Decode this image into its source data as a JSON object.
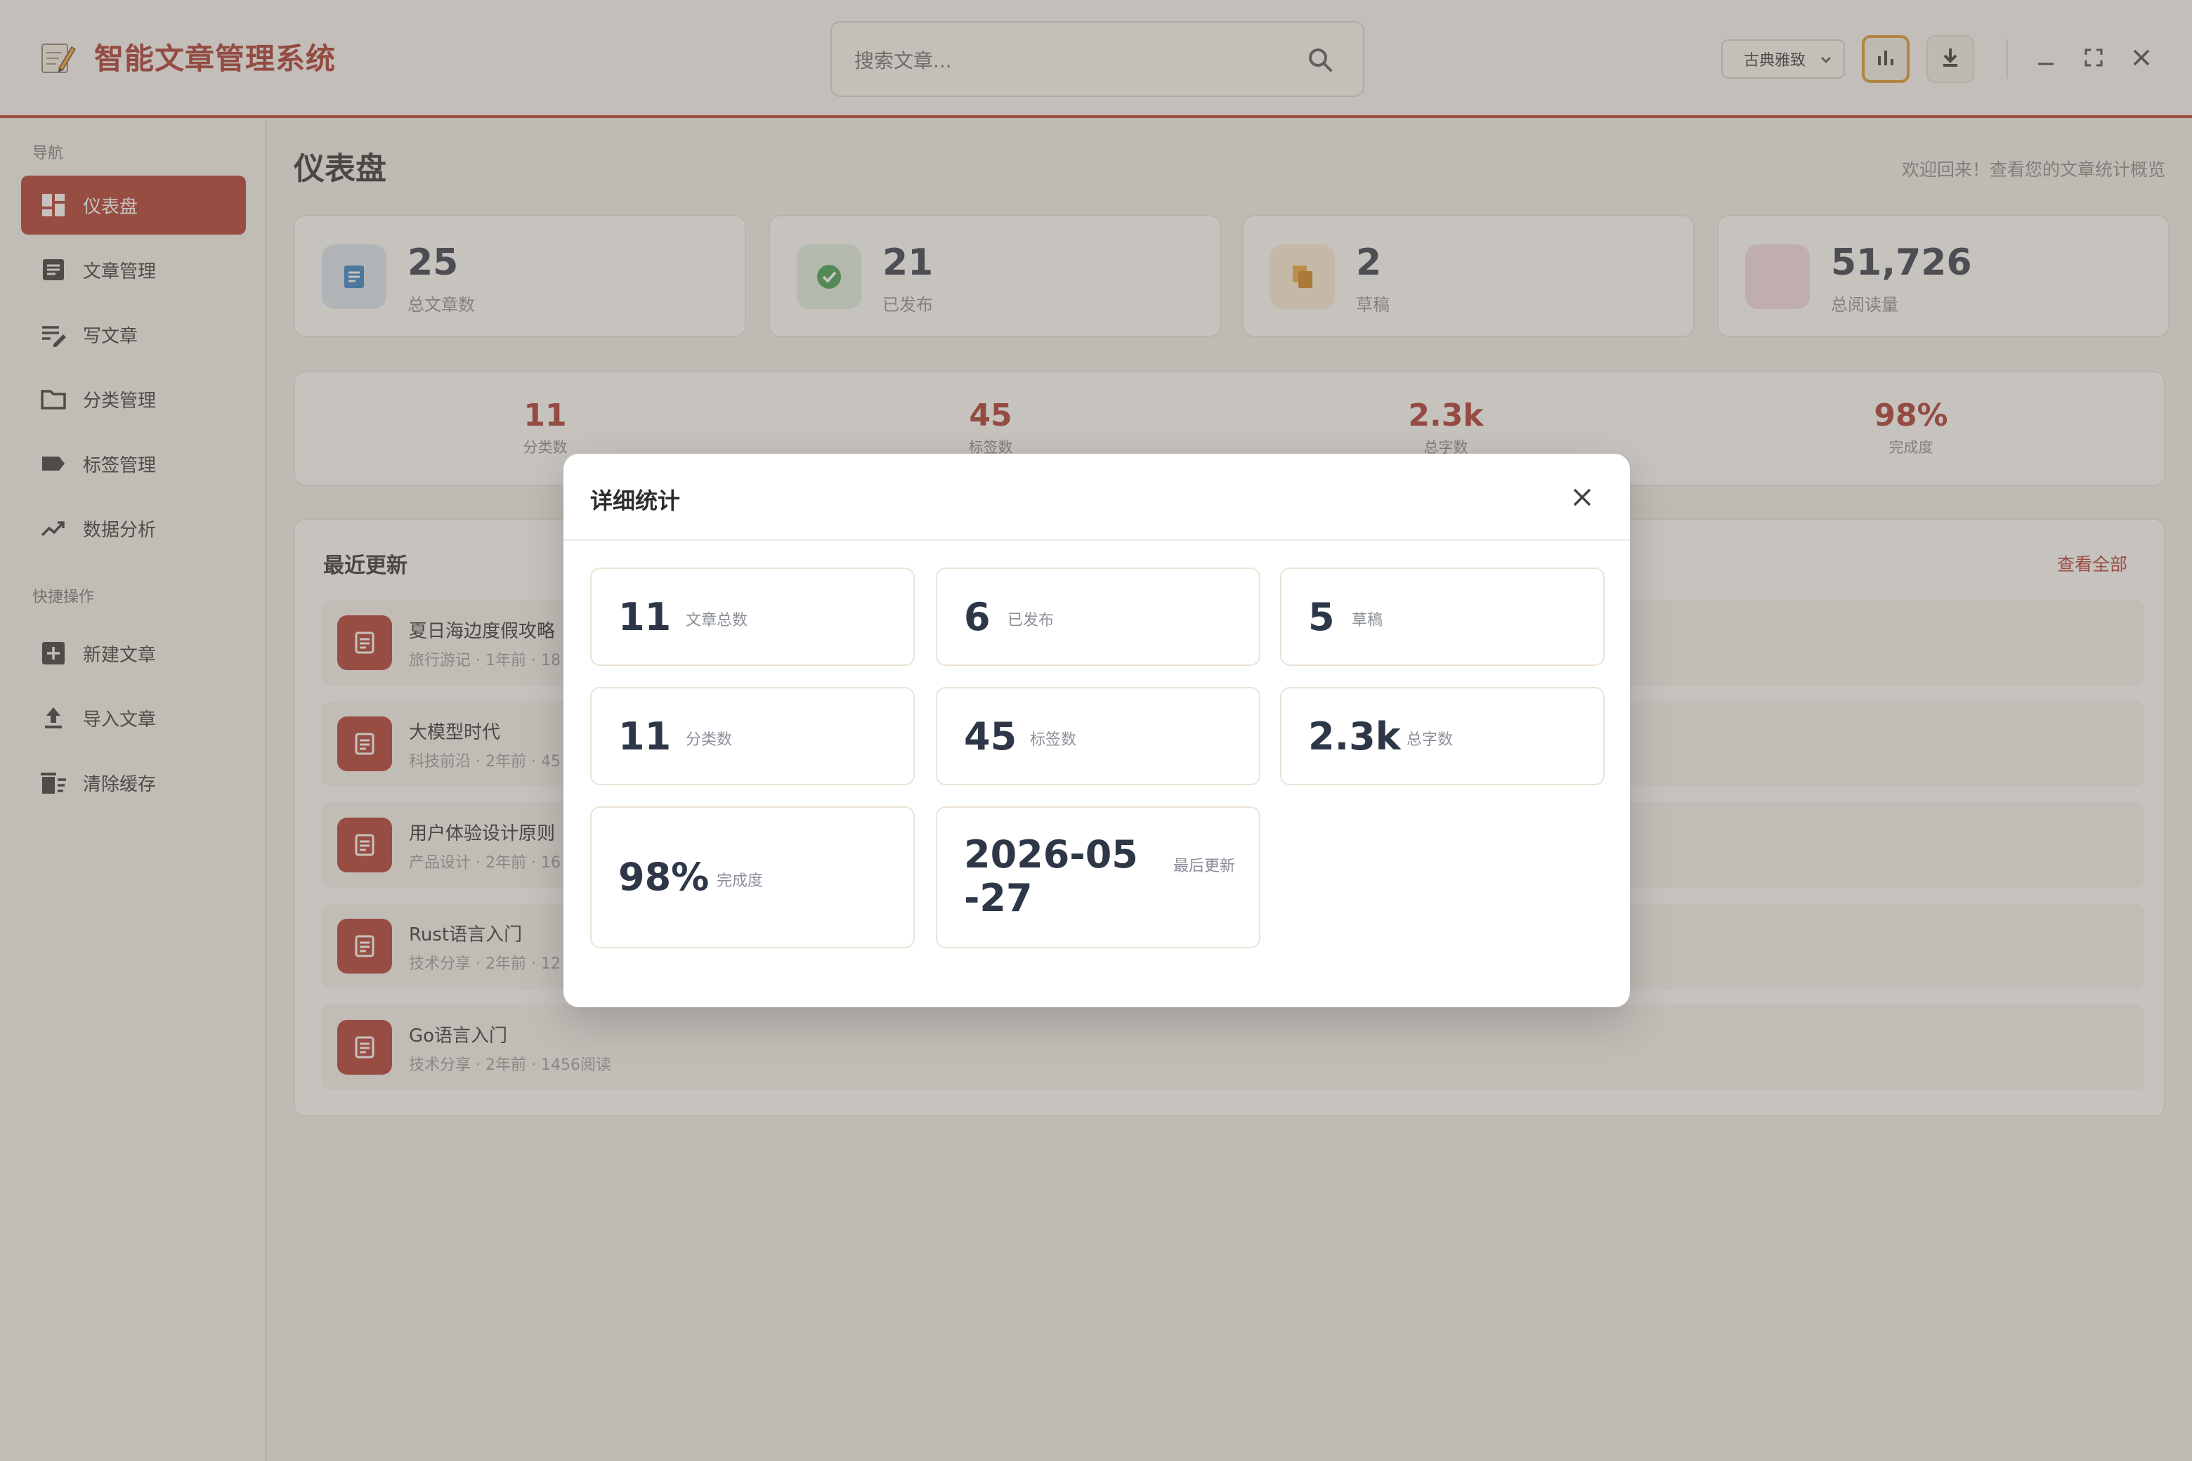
{
  "app": {
    "title": "智能文章管理系统",
    "search_placeholder": "搜索文章...",
    "theme_selected": "古典雅致",
    "accent_color": "#b0362c"
  },
  "sidebar": {
    "nav_title": "导航",
    "nav_items": [
      {
        "label": "仪表盘",
        "icon": "dashboard-icon",
        "active": true
      },
      {
        "label": "文章管理",
        "icon": "article-icon"
      },
      {
        "label": "写文章",
        "icon": "edit-note-icon"
      },
      {
        "label": "分类管理",
        "icon": "folder-icon"
      },
      {
        "label": "标签管理",
        "icon": "tag-icon"
      },
      {
        "label": "数据分析",
        "icon": "trending-up-icon"
      }
    ],
    "quick_title": "快捷操作",
    "quick_items": [
      {
        "label": "新建文章",
        "icon": "add-box-icon"
      },
      {
        "label": "导入文章",
        "icon": "upload-icon"
      },
      {
        "label": "清除缓存",
        "icon": "clear-cache-icon"
      }
    ]
  },
  "main": {
    "title": "仪表盘",
    "welcome": "欢迎回来！查看您的文章统计概览",
    "stats": [
      {
        "value": "25",
        "label": "总文章数",
        "icon": "document-icon"
      },
      {
        "value": "21",
        "label": "已发布",
        "icon": "check-circle-icon"
      },
      {
        "value": "2",
        "label": "草稿",
        "icon": "copy-icon"
      },
      {
        "value": "51,726",
        "label": "总阅读量",
        "icon": "eye-icon"
      }
    ],
    "summary": [
      {
        "value": "11",
        "label": "分类数"
      },
      {
        "value": "45",
        "label": "标签数"
      },
      {
        "value": "2.3k",
        "label": "总字数"
      },
      {
        "value": "98%",
        "label": "完成度"
      }
    ],
    "recent": {
      "title": "最近更新",
      "view_all": "查看全部",
      "items": [
        {
          "title": "夏日海边度假攻略",
          "meta": "旅行游记 · 1年前 · 18"
        },
        {
          "title": "大模型时代",
          "meta": "科技前沿 · 2年前 · 45"
        },
        {
          "title": "用户体验设计原则",
          "meta": "产品设计 · 2年前 · 16"
        },
        {
          "title": "Rust语言入门",
          "meta": "技术分享 · 2年前 · 12"
        },
        {
          "title": "Go语言入门",
          "meta": "技术分享 · 2年前 · 1456阅读"
        }
      ]
    }
  },
  "modal": {
    "title": "详细统计",
    "cards": [
      {
        "value": "11",
        "label": "文章总数"
      },
      {
        "value": "6",
        "label": "已发布"
      },
      {
        "value": "5",
        "label": "草稿"
      },
      {
        "value": "11",
        "label": "分类数"
      },
      {
        "value": "45",
        "label": "标签数"
      },
      {
        "value": "2.3k",
        "label": "总字数"
      },
      {
        "value": "98%",
        "label": "完成度"
      },
      {
        "value": "2026-05-27",
        "label": "最后更新"
      }
    ]
  }
}
